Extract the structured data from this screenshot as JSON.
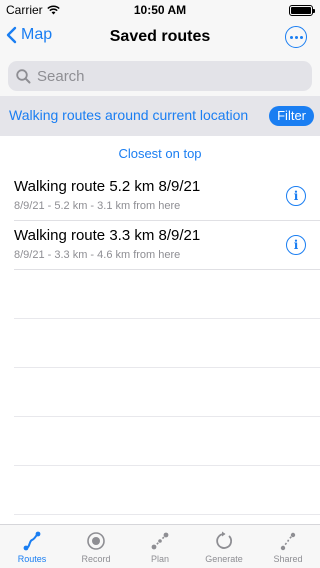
{
  "status_bar": {
    "carrier": "Carrier",
    "time": "10:50 AM"
  },
  "nav": {
    "back_label": "Map",
    "title": "Saved routes"
  },
  "search": {
    "placeholder": "Search"
  },
  "filter_bar": {
    "text": "Walking routes around current location",
    "button_label": "Filter"
  },
  "sort_label": "Closest on top",
  "routes": [
    {
      "title": "Walking route 5.2 km 8/9/21",
      "subtitle": "8/9/21 - 5.2 km - 3.1 km from here"
    },
    {
      "title": "Walking route 3.3 km 8/9/21",
      "subtitle": "8/9/21 - 3.3 km - 4.6 km from here"
    }
  ],
  "tabs": [
    {
      "label": "Routes",
      "icon": "routes-icon",
      "active": true
    },
    {
      "label": "Record",
      "icon": "record-icon",
      "active": false
    },
    {
      "label": "Plan",
      "icon": "plan-icon",
      "active": false
    },
    {
      "label": "Generate",
      "icon": "generate-icon",
      "active": false
    },
    {
      "label": "Shared",
      "icon": "shared-icon",
      "active": false
    }
  ],
  "colors": {
    "accent": "#1a7ef2",
    "secondary_text": "#8e8e93",
    "filter_bar_bg": "#e5e5ea"
  }
}
